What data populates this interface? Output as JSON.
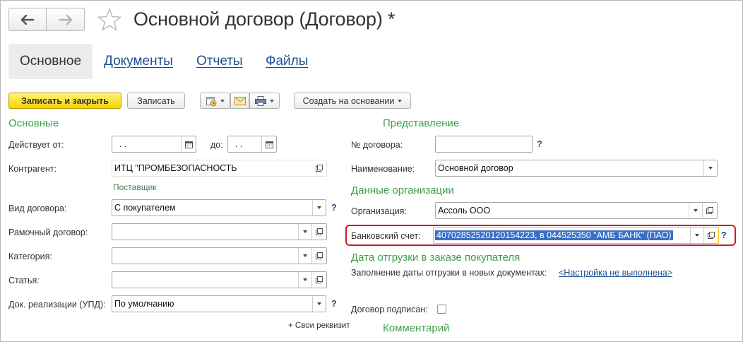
{
  "window": {
    "title": "Основной договор (Договор) *"
  },
  "tabs": [
    {
      "label": "Основное",
      "active": true
    },
    {
      "label": "Документы",
      "active": false
    },
    {
      "label": "Отчеты",
      "active": false
    },
    {
      "label": "Файлы",
      "active": false
    }
  ],
  "toolbar": {
    "save_close_label": "Записать и закрыть",
    "save_label": "Записать",
    "create_based_label": "Создать на основании"
  },
  "left": {
    "section_title": "Основные",
    "valid_from_label": "Действует от:",
    "valid_from_value": " .  .",
    "valid_to_label": "до:",
    "valid_to_value": " .  .",
    "counterparty_label": "Контрагент:",
    "counterparty_value": "ИТЦ \"ПРОМБЕЗОПАСНОСТЬ",
    "counterparty_hint": "Поставщик",
    "contract_type_label": "Вид договора:",
    "contract_type_value": "С покупателем",
    "frame_contract_label": "Рамочный договор:",
    "frame_contract_value": "",
    "category_label": "Категория:",
    "category_value": "",
    "article_label": "Статья:",
    "article_value": "",
    "upd_label": "Док. реализации (УПД):",
    "upd_value": "По умолчанию",
    "custom_props_label": "+ Свои реквизит"
  },
  "right": {
    "section_title": "Представление",
    "contract_no_label": "№ договора:",
    "contract_no_value": "",
    "name_label": "Наименование:",
    "name_value": "Основной договор",
    "org_section_title": "Данные организации",
    "org_label": "Организация:",
    "org_value": "Ассоль ООО",
    "bank_label": "Банковский счет:",
    "bank_value": "40702852520120154223, в 044525350 \"АМБ БАНК\" (ПАО)",
    "shipment_section_title": "Дата отгрузки в заказе покупателя",
    "shipment_fill_label": "Заполнение даты отгрузки в новых документах:",
    "shipment_fill_link": "<Настройка не выполнена>",
    "signed_label": "Договор подписан:",
    "signed_checked": false,
    "comment_section_title": "Комментарий"
  },
  "help_mark": "?",
  "colors": {
    "section_green": "#3f9e4a",
    "link_blue": "#1c4f93",
    "primary_yellow": "#f5d400",
    "highlight_red": "#c81e24",
    "selection_blue": "#3b6fc5"
  },
  "icons": [
    "back-arrow-icon",
    "forward-arrow-icon",
    "star-icon",
    "calendar-icon",
    "envelope-icon",
    "printer-icon",
    "open-form-icon",
    "dropdown-caret-icon"
  ]
}
